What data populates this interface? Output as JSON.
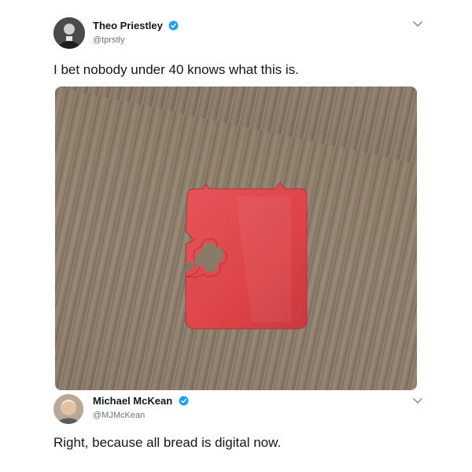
{
  "tweet": {
    "author": {
      "display_name": "Theo Priestley",
      "handle": "@tprstly",
      "verified": true,
      "avatar_icon": "profile-photo-avatar"
    },
    "text": "I bet nobody under 40 knows what this is.",
    "media": {
      "subject_icon": "bread-clip-photo"
    },
    "menu_icon": "chevron-down-icon"
  },
  "reply": {
    "author": {
      "display_name": "Michael McKean",
      "handle": "@MJMcKean",
      "verified": true,
      "avatar_icon": "profile-photo-avatar"
    },
    "text": "Right, because all bread is digital now.",
    "menu_icon": "chevron-down-icon"
  },
  "colors": {
    "verified_badge": "#1da1f2",
    "handle_text": "#657786",
    "body_text": "#14171a",
    "clip_red": "#e0474c"
  }
}
